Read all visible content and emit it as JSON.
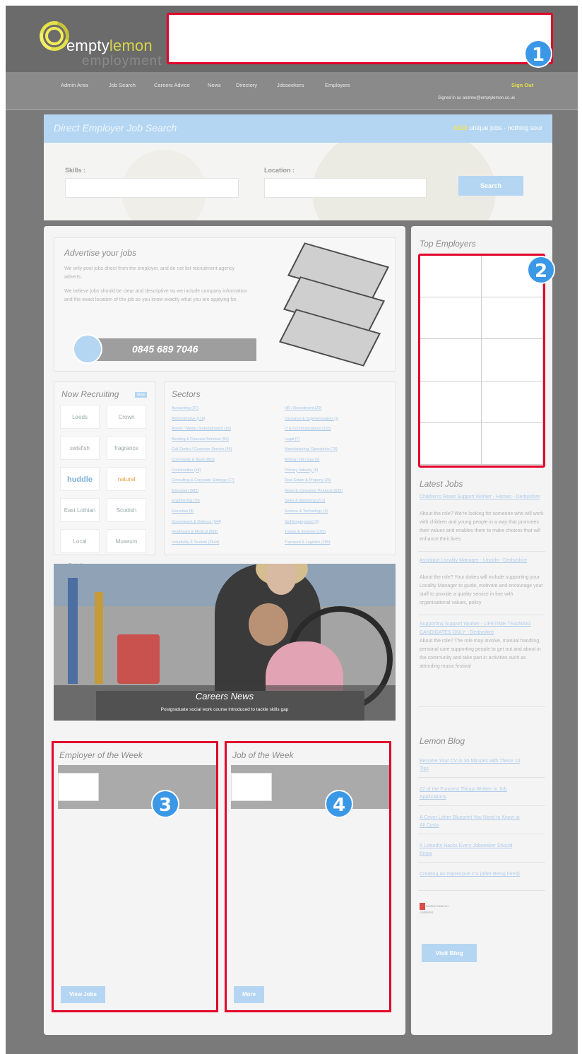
{
  "colors": {
    "accent_red": "#e3002a",
    "badge_blue": "#3b98e6",
    "light_blue": "#b4d6f2",
    "lemon": "#e6e14a"
  },
  "logo": {
    "word1": "empty",
    "word2": "lemon",
    "word3": "employment"
  },
  "nav": {
    "items": [
      "Admin Area",
      "Job Search",
      "Careers Advice",
      "News",
      "Directory",
      "Jobseekers",
      "Employers"
    ],
    "sign_out": "Sign Out",
    "signed_in": "Signed in as andrew@emptylemon.co.uk"
  },
  "badges": {
    "b1": "1",
    "b2": "2",
    "b3": "3",
    "b4": "4"
  },
  "search": {
    "title": "Direct Employer Job Search",
    "count": "8220",
    "count_suffix": "unique jobs - nothing sour",
    "skills_label": "Skills :",
    "location_label": "Location :",
    "button": "Search"
  },
  "advertise": {
    "title": "Advertise your jobs",
    "p1": "We only post jobs direct from the employer, and do not list recruitment agency adverts.",
    "p2": "We believe jobs should be clear and descriptive so we include company information and the exact location of the job so you know exactly what you are applying for.",
    "phone": "0845 689 7046"
  },
  "recruiting": {
    "title": "Now Recruiting",
    "more": "More",
    "logos": [
      "Leeds",
      "Crown",
      "swisfish",
      "fragrance",
      "huddle",
      "natural",
      "East Lothian",
      "Scottish Borders",
      "Local Solutions",
      "Museum"
    ]
  },
  "sectors": {
    "title": "Sectors",
    "left": [
      "Accounting (97)",
      "Administrative (118)",
      "Advert / Media / Entertainment (16)",
      "Banking & Financial Services (56)",
      "Call Centre / Customer Service (46)",
      "Community & Sport (853)",
      "Construction (18)",
      "Consulting & Corporate Strategy (17)",
      "Education (582)",
      "Engineering (75)",
      "Executive (8)",
      "Government & Defence (344)",
      "Healthcare & Medical (669)",
      "Hospitality & Tourism (2544)"
    ],
    "right": [
      "HR / Recruitment (29)",
      "Insurance & Superannuation (1)",
      "IT & Communications (133)",
      "Legal (7)",
      "Manufacturing, Operations (79)",
      "Mining / Oil / Gas (5)",
      "Primary Industry (8)",
      "Real Estate & Property (25)",
      "Retail & Consumer Products (535)",
      "Sales & Marketing (211)",
      "Science & Technology (4)",
      "Self Employment (5)",
      "Trades & Services (105)",
      "Transport & Logistics (280)"
    ]
  },
  "news": {
    "title": "Careers News",
    "subtitle": "Postgraduate social work course introduced to tackle skills gap"
  },
  "employer_week": {
    "title": "Employer of the Week",
    "button": "View Jobs"
  },
  "job_week": {
    "title": "Job of the Week",
    "button": "More"
  },
  "sidebar": {
    "top_employers": "Top Employers",
    "latest_jobs": "Latest Jobs",
    "jobs": [
      {
        "title": "Children's Reset Support Worker - Homes - Derbyshire",
        "desc": "About the role? We're looking for someone who will work with children and young people in a way that promotes their values and enables them to make choices that will enhance their lives"
      },
      {
        "title": "Assistant Locality Manager - Lincoln - Derbyshire",
        "desc": "About the role? Your duties will include supporting your Locality Manager to guide, motivate and encourage your staff to provide a quality service in line with organisational values, policy"
      },
      {
        "title": "Supporting Support Worker - LIFETIME TRAINING CANDIDATES ONLY - Derbyshire",
        "desc": "About the role? The role may involve, manual handling, personal care supporting people to get out and about in the community and take part in activities such as attending music festival"
      }
    ],
    "blog_title": "Lemon Blog",
    "blog_links": [
      "Become Your CV in 30 Minutes with These 10 Tips",
      "22 of the Funniest Things Written in Job Applications",
      "A Cover Letter Blueprint You Need to Know to All Costs",
      "5 LinkedIn Hacks Every Jobseeker Should Know",
      "Creating an Impressive CV (after Being Fired)"
    ],
    "blog_badge": "WORLD HEALTH CAREERS",
    "visit_blog": "Visit Blog"
  }
}
